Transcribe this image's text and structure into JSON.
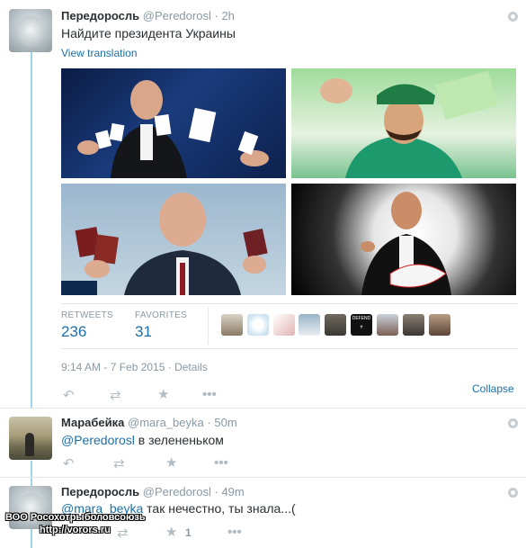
{
  "tweet1": {
    "name": "Передоросль",
    "handle": "@Peredorosl",
    "time": "2h",
    "text": "Найдите президента Украины",
    "view_translation": "View translation",
    "retweets_label": "RETWEETS",
    "retweets_count": "236",
    "favorites_label": "FAVORITES",
    "favorites_count": "31",
    "timestamp": "9:14 AM - 7 Feb 2015",
    "separator": "·",
    "details": "Details",
    "collapse": "Collapse",
    "favoriter_avatars": [
      "avatar-1",
      "avatar-2",
      "avatar-3",
      "avatar-4",
      "avatar-5",
      "avatar-6",
      "avatar-7",
      "avatar-8",
      "avatar-9"
    ],
    "defend_badge": "DEFEND"
  },
  "reply1": {
    "name": "Марабейка",
    "handle": "@mara_beyka",
    "time": "50m",
    "mention": "@Peredorosl",
    "text": " в зелененьком"
  },
  "reply2": {
    "name": "Передоросль",
    "handle": "@Peredorosl",
    "time": "49m",
    "mention": "@mara_beyka",
    "text": " так нечестно, ты знала...(",
    "favorite_count": "1"
  },
  "watermark": {
    "line1": "ВОО Росохотрыболовсоюзь",
    "line2": "http://vorors.ru"
  },
  "icons": [
    "reply-icon",
    "retweet-icon",
    "favorite-icon",
    "more-icon",
    "gear-icon"
  ],
  "colors": {
    "link": "#1b6fa8",
    "thread": "#9ed7e9",
    "muted": "#8899a6"
  }
}
